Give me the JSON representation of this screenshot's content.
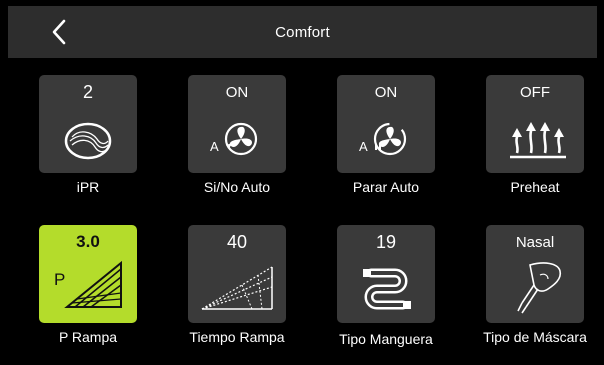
{
  "header": {
    "title": "Comfort",
    "back_icon": "chevron-left-icon"
  },
  "tiles": [
    {
      "value": "2",
      "label": "iPR",
      "icon": "ipr-icon"
    },
    {
      "value": "ON",
      "label": "Si/No Auto",
      "icon": "auto-fan-icon"
    },
    {
      "value": "ON",
      "label": "Parar Auto",
      "icon": "auto-stop-fan-icon"
    },
    {
      "value": "OFF",
      "label": "Preheat",
      "icon": "preheat-icon"
    },
    {
      "value": "3.0",
      "label": "P Rampa",
      "icon": "pressure-ramp-icon",
      "icon_letter": "P"
    },
    {
      "value": "40",
      "label": "Tiempo Rampa",
      "icon": "ramp-time-icon"
    },
    {
      "value": "19",
      "label": "Tipo Manguera",
      "icon": "hose-icon"
    },
    {
      "value": "Nasal",
      "label": "Tipo de Máscara",
      "icon": "mask-icon"
    }
  ],
  "icon_letters": {
    "auto": "A"
  },
  "colors": {
    "active_tile": "#b4dc2b",
    "tile": "#3a3a3a",
    "header": "#2d2d2d"
  }
}
